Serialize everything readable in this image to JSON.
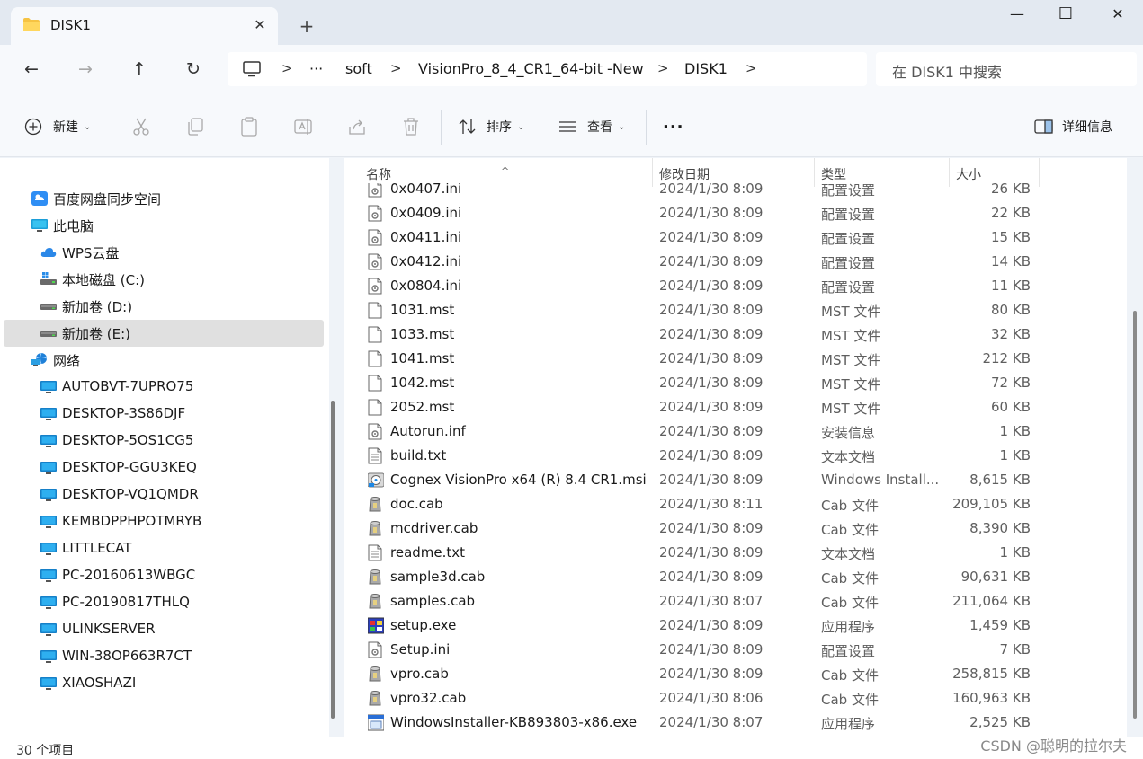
{
  "window": {
    "tab_title": "DISK1",
    "tab_close": "✕",
    "new_tab": "+",
    "minimize": "—",
    "maximize": "☐",
    "close": "✕"
  },
  "nav": {
    "back": "←",
    "forward": "→",
    "up": "↑",
    "refresh": "↻",
    "breadcrumb": [
      "···",
      "soft",
      "VisionPro_8_4_CR1_64-bit -New",
      "DISK1"
    ],
    "separator": ">",
    "search_placeholder": "在 DISK1 中搜索"
  },
  "toolbar": {
    "new_label": "新建",
    "sort_label": "排序",
    "view_label": "查看",
    "more_label": "···",
    "details_label": "详细信息",
    "chevron": "⌄"
  },
  "sidebar": {
    "items": [
      {
        "label": "百度网盘同步空间",
        "icon": "baidu-netdisk-icon",
        "indent": 1
      },
      {
        "label": "此电脑",
        "icon": "this-pc-icon",
        "indent": 1
      },
      {
        "label": "WPS云盘",
        "icon": "wps-cloud-icon",
        "indent": 2
      },
      {
        "label": "本地磁盘 (C:)",
        "icon": "system-drive-icon",
        "indent": 2
      },
      {
        "label": "新加卷 (D:)",
        "icon": "drive-icon",
        "indent": 2
      },
      {
        "label": "新加卷 (E:)",
        "icon": "drive-icon",
        "indent": 2,
        "selected": true
      },
      {
        "label": "网络",
        "icon": "network-icon",
        "indent": 1
      },
      {
        "label": "AUTOBVT-7UPRO75",
        "icon": "computer-icon",
        "indent": 2
      },
      {
        "label": "DESKTOP-3S86DJF",
        "icon": "computer-icon",
        "indent": 2
      },
      {
        "label": "DESKTOP-5OS1CG5",
        "icon": "computer-icon",
        "indent": 2
      },
      {
        "label": "DESKTOP-GGU3KEQ",
        "icon": "computer-icon",
        "indent": 2
      },
      {
        "label": "DESKTOP-VQ1QMDR",
        "icon": "computer-icon",
        "indent": 2
      },
      {
        "label": "KEMBDPPHPOTMRYB",
        "icon": "computer-icon",
        "indent": 2
      },
      {
        "label": "LITTLECAT",
        "icon": "computer-icon",
        "indent": 2
      },
      {
        "label": "PC-20160613WBGC",
        "icon": "computer-icon",
        "indent": 2
      },
      {
        "label": "PC-20190817THLQ",
        "icon": "computer-icon",
        "indent": 2
      },
      {
        "label": "ULINKSERVER",
        "icon": "computer-icon",
        "indent": 2
      },
      {
        "label": "WIN-38OP663R7CT",
        "icon": "computer-icon",
        "indent": 2
      },
      {
        "label": "XIAOSHAZI",
        "icon": "computer-icon",
        "indent": 2
      }
    ]
  },
  "columns": {
    "name": "名称",
    "date": "修改日期",
    "type": "类型",
    "size": "大小",
    "sort_indicator": "^"
  },
  "files": [
    {
      "name": "0x0407.ini",
      "date": "2024/1/30 8:09",
      "type": "配置设置",
      "size": "26 KB",
      "icon": "ini-file-icon"
    },
    {
      "name": "0x0409.ini",
      "date": "2024/1/30 8:09",
      "type": "配置设置",
      "size": "22 KB",
      "icon": "ini-file-icon"
    },
    {
      "name": "0x0411.ini",
      "date": "2024/1/30 8:09",
      "type": "配置设置",
      "size": "15 KB",
      "icon": "ini-file-icon"
    },
    {
      "name": "0x0412.ini",
      "date": "2024/1/30 8:09",
      "type": "配置设置",
      "size": "14 KB",
      "icon": "ini-file-icon"
    },
    {
      "name": "0x0804.ini",
      "date": "2024/1/30 8:09",
      "type": "配置设置",
      "size": "11 KB",
      "icon": "ini-file-icon"
    },
    {
      "name": "1031.mst",
      "date": "2024/1/30 8:09",
      "type": "MST 文件",
      "size": "80 KB",
      "icon": "blank-file-icon"
    },
    {
      "name": "1033.mst",
      "date": "2024/1/30 8:09",
      "type": "MST 文件",
      "size": "32 KB",
      "icon": "blank-file-icon"
    },
    {
      "name": "1041.mst",
      "date": "2024/1/30 8:09",
      "type": "MST 文件",
      "size": "212 KB",
      "icon": "blank-file-icon"
    },
    {
      "name": "1042.mst",
      "date": "2024/1/30 8:09",
      "type": "MST 文件",
      "size": "72 KB",
      "icon": "blank-file-icon"
    },
    {
      "name": "2052.mst",
      "date": "2024/1/30 8:09",
      "type": "MST 文件",
      "size": "60 KB",
      "icon": "blank-file-icon"
    },
    {
      "name": "Autorun.inf",
      "date": "2024/1/30 8:09",
      "type": "安装信息",
      "size": "1 KB",
      "icon": "ini-file-icon"
    },
    {
      "name": "build.txt",
      "date": "2024/1/30 8:09",
      "type": "文本文档",
      "size": "1 KB",
      "icon": "text-file-icon"
    },
    {
      "name": "Cognex VisionPro x64 (R) 8.4 CR1.msi",
      "date": "2024/1/30 8:09",
      "type": "Windows Install...",
      "size": "8,615 KB",
      "icon": "msi-file-icon"
    },
    {
      "name": "doc.cab",
      "date": "2024/1/30 8:11",
      "type": "Cab 文件",
      "size": "209,105 KB",
      "icon": "cab-file-icon"
    },
    {
      "name": "mcdriver.cab",
      "date": "2024/1/30 8:09",
      "type": "Cab 文件",
      "size": "8,390 KB",
      "icon": "cab-file-icon"
    },
    {
      "name": "readme.txt",
      "date": "2024/1/30 8:09",
      "type": "文本文档",
      "size": "1 KB",
      "icon": "text-file-icon"
    },
    {
      "name": "sample3d.cab",
      "date": "2024/1/30 8:09",
      "type": "Cab 文件",
      "size": "90,631 KB",
      "icon": "cab-file-icon"
    },
    {
      "name": "samples.cab",
      "date": "2024/1/30 8:07",
      "type": "Cab 文件",
      "size": "211,064 KB",
      "icon": "cab-file-icon"
    },
    {
      "name": "setup.exe",
      "date": "2024/1/30 8:09",
      "type": "应用程序",
      "size": "1,459 KB",
      "icon": "setup-exe-icon"
    },
    {
      "name": "Setup.ini",
      "date": "2024/1/30 8:09",
      "type": "配置设置",
      "size": "7 KB",
      "icon": "ini-file-icon"
    },
    {
      "name": "vpro.cab",
      "date": "2024/1/30 8:09",
      "type": "Cab 文件",
      "size": "258,815 KB",
      "icon": "cab-file-icon"
    },
    {
      "name": "vpro32.cab",
      "date": "2024/1/30 8:06",
      "type": "Cab 文件",
      "size": "160,963 KB",
      "icon": "cab-file-icon"
    },
    {
      "name": "WindowsInstaller-KB893803-x86.exe",
      "date": "2024/1/30 8:07",
      "type": "应用程序",
      "size": "2,525 KB",
      "icon": "installer-exe-icon"
    }
  ],
  "status": {
    "item_count": "30 个项目"
  },
  "watermark": "CSDN @聪明的拉尔夫"
}
